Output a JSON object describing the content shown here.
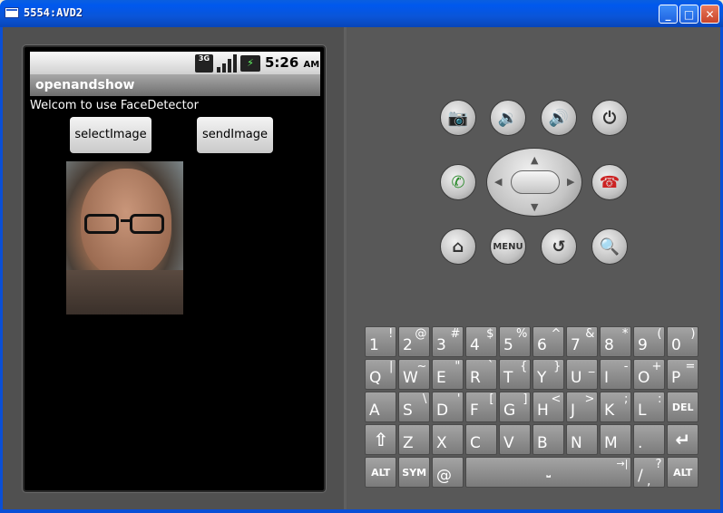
{
  "window": {
    "title": "5554:AVD2",
    "minimize": "_",
    "maximize": "□",
    "close": "✕"
  },
  "statusbar": {
    "network": "3G",
    "time": "5:26",
    "ampm": "AM"
  },
  "app": {
    "title": "openandshow",
    "welcome": "Welcom to use FaceDetector",
    "select_button": "selectImage",
    "send_button": "sendImage"
  },
  "controls": {
    "menu_label": "MENU"
  },
  "keyboard": {
    "row1": [
      {
        "main": "1",
        "alt": "!"
      },
      {
        "main": "2",
        "alt": "@"
      },
      {
        "main": "3",
        "alt": "#"
      },
      {
        "main": "4",
        "alt": "$"
      },
      {
        "main": "5",
        "alt": "%"
      },
      {
        "main": "6",
        "alt": "^"
      },
      {
        "main": "7",
        "alt": "&"
      },
      {
        "main": "8",
        "alt": "*"
      },
      {
        "main": "9",
        "alt": "("
      },
      {
        "main": "0",
        "alt": ")"
      }
    ],
    "row2": [
      {
        "main": "Q",
        "alt": "|"
      },
      {
        "main": "W",
        "alt": "~"
      },
      {
        "main": "E",
        "alt": "\""
      },
      {
        "main": "R",
        "alt": "`"
      },
      {
        "main": "T",
        "alt": "{"
      },
      {
        "main": "Y",
        "alt": "}"
      },
      {
        "main": "U",
        "alt": "_"
      },
      {
        "main": "I",
        "alt": "-"
      },
      {
        "main": "O",
        "alt": "+"
      },
      {
        "main": "P",
        "alt": "="
      }
    ],
    "row3": [
      {
        "main": "A",
        "alt": ""
      },
      {
        "main": "S",
        "alt": "\\"
      },
      {
        "main": "D",
        "alt": "'"
      },
      {
        "main": "F",
        "alt": "["
      },
      {
        "main": "G",
        "alt": "]"
      },
      {
        "main": "H",
        "alt": "<"
      },
      {
        "main": "J",
        "alt": ">"
      },
      {
        "main": "K",
        "alt": ";"
      },
      {
        "main": "L",
        "alt": ":"
      },
      {
        "main": "DEL",
        "alt": ""
      }
    ],
    "row4": [
      {
        "main": "⇧",
        "alt": ""
      },
      {
        "main": "Z",
        "alt": ""
      },
      {
        "main": "X",
        "alt": ""
      },
      {
        "main": "C",
        "alt": ""
      },
      {
        "main": "V",
        "alt": ""
      },
      {
        "main": "B",
        "alt": ""
      },
      {
        "main": "N",
        "alt": ""
      },
      {
        "main": "M",
        "alt": ""
      },
      {
        "main": ".",
        "alt": ""
      },
      {
        "main": "↵",
        "alt": ""
      }
    ],
    "row5": {
      "alt_left": "ALT",
      "sym": "SYM",
      "at": "@",
      "space": "⎵",
      "tab": "→|",
      "slash": "/",
      "question": "?",
      "comma": ",",
      "alt_right": "ALT"
    }
  },
  "icons": {
    "camera": "camera-icon",
    "vol_down": "volume-down-icon",
    "vol_up": "volume-up-icon",
    "power": "power-icon",
    "call": "call-icon",
    "end_call": "end-call-icon",
    "home": "home-icon",
    "back": "back-icon",
    "search": "search-icon"
  }
}
